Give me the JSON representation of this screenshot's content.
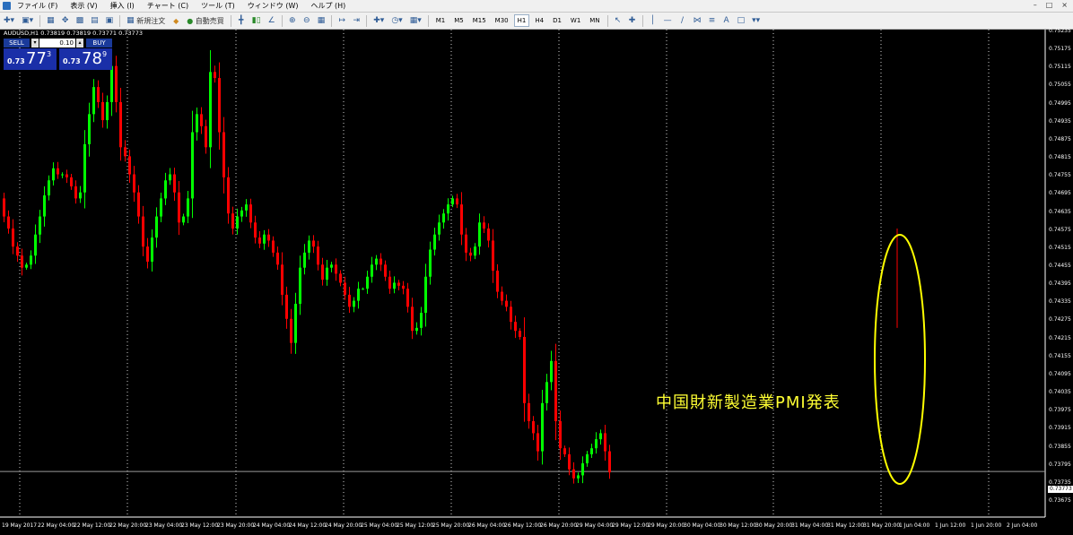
{
  "menu": [
    "ファイル (F)",
    "表示 (V)",
    "挿入 (I)",
    "チャート (C)",
    "ツール (T)",
    "ウィンドウ (W)",
    "ヘルプ (H)"
  ],
  "toolbar": {
    "new_order": "新規注文",
    "auto_trading": "自動売買",
    "timeframes": [
      "M1",
      "M5",
      "M15",
      "M30",
      "H1",
      "H4",
      "D1",
      "W1",
      "MN"
    ],
    "active_timeframe": "H1"
  },
  "chart": {
    "title": "AUDUSD,H1  0.73819 0.73819 0.73771 0.73773",
    "annotation": "中国財新製造業PMI発表",
    "current_price_label": "0.73773",
    "up_color": "#00ff00",
    "down_color": "#ff0000",
    "annotation_color": "#ffff00"
  },
  "trade_panel": {
    "sell_label": "SELL",
    "buy_label": "BUY",
    "lot": "0.10",
    "sell_small": "0.73",
    "sell_big": "77",
    "sell_sup": "3",
    "buy_small": "0.73",
    "buy_big": "78",
    "buy_sup": "9"
  },
  "price_axis": [
    "0.75235",
    "0.75175",
    "0.75115",
    "0.75055",
    "0.74995",
    "0.74935",
    "0.74875",
    "0.74815",
    "0.74755",
    "0.74695",
    "0.74635",
    "0.74575",
    "0.74515",
    "0.74455",
    "0.74395",
    "0.74335",
    "0.74275",
    "0.74215",
    "0.74155",
    "0.74095",
    "0.74035",
    "0.73975",
    "0.73915",
    "0.73855",
    "0.73795",
    "0.73735",
    "0.73675"
  ],
  "time_axis": [
    "19 May 2017",
    "22 May 04:00",
    "22 May 12:00",
    "22 May 20:00",
    "23 May 04:00",
    "23 May 12:00",
    "23 May 20:00",
    "24 May 04:00",
    "24 May 12:00",
    "24 May 20:00",
    "25 May 04:00",
    "25 May 12:00",
    "25 May 20:00",
    "26 May 04:00",
    "26 May 12:00",
    "26 May 20:00",
    "29 May 04:00",
    "29 May 12:00",
    "29 May 20:00",
    "30 May 04:00",
    "30 May 12:00",
    "30 May 20:00",
    "31 May 04:00",
    "31 May 12:00",
    "31 May 20:00",
    "1 Jun 04:00",
    "1 Jun 12:00",
    "1 Jun 20:00",
    "2 Jun 04:00"
  ],
  "chart_data": {
    "type": "candlestick",
    "symbol": "AUDUSD",
    "timeframe": "H1",
    "ohlc": {
      "open": 0.73819,
      "high": 0.73819,
      "low": 0.73771,
      "close": 0.73773
    },
    "ylim": [
      0.73675,
      0.75235
    ],
    "x_range": [
      "19 May 2017",
      "2 Jun 04:00"
    ],
    "grid": "vertical dotted",
    "path_close": [
      0.7462,
      0.7458,
      0.7452,
      0.7449,
      0.7445,
      0.7446,
      0.7449,
      0.7456,
      0.7462,
      0.7469,
      0.7474,
      0.7478,
      0.7476,
      0.7476,
      0.7475,
      0.7472,
      0.7468,
      0.747,
      0.7486,
      0.7496,
      0.7505,
      0.75,
      0.7494,
      0.75,
      0.7512,
      0.75,
      0.7485,
      0.7482,
      0.7476,
      0.747,
      0.7462,
      0.7452,
      0.7447,
      0.7455,
      0.7462,
      0.7468,
      0.7474,
      0.7476,
      0.747,
      0.746,
      0.7462,
      0.7468,
      0.749,
      0.7496,
      0.7492,
      0.7485,
      0.751,
      0.7508,
      0.749,
      0.7475,
      0.7463,
      0.7458,
      0.7462,
      0.7464,
      0.7466,
      0.746,
      0.7455,
      0.7453,
      0.7456,
      0.7454,
      0.745,
      0.7446,
      0.7436,
      0.7428,
      0.742,
      0.7433,
      0.7445,
      0.745,
      0.7454,
      0.7452,
      0.7446,
      0.7441,
      0.7445,
      0.7446,
      0.7443,
      0.744,
      0.7436,
      0.7432,
      0.7434,
      0.7438,
      0.7438,
      0.7442,
      0.7446,
      0.7448,
      0.7446,
      0.7442,
      0.7438,
      0.744,
      0.7439,
      0.7438,
      0.7432,
      0.7424,
      0.7425,
      0.743,
      0.7442,
      0.7451,
      0.7456,
      0.746,
      0.7463,
      0.7466,
      0.7468,
      0.7466,
      0.7456,
      0.745,
      0.7449,
      0.7452,
      0.746,
      0.7458,
      0.7454,
      0.7444,
      0.7437,
      0.7434,
      0.7432,
      0.7427,
      0.7424,
      0.7422,
      0.74,
      0.7394,
      0.739,
      0.7384,
      0.74,
      0.7407,
      0.7414,
      0.7394,
      0.7385,
      0.7383,
      0.7378,
      0.7375,
      0.7376,
      0.738,
      0.7383,
      0.7385,
      0.7388,
      0.739,
      0.7384,
      0.7377
    ]
  }
}
